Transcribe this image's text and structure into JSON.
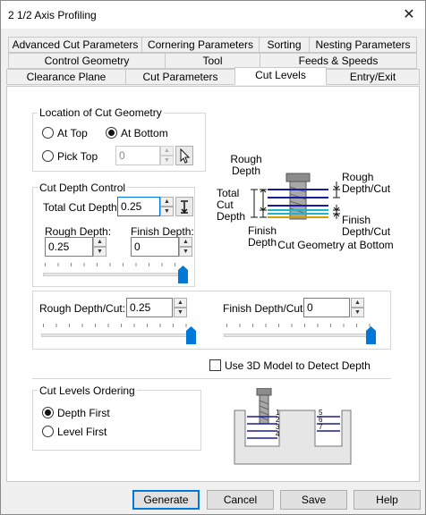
{
  "window": {
    "title": "2 1/2 Axis Profiling"
  },
  "tabs": {
    "row1": [
      "Advanced Cut Parameters",
      "Cornering Parameters",
      "Sorting",
      "Nesting Parameters"
    ],
    "row2": [
      "Control Geometry",
      "Tool",
      "Feeds & Speeds"
    ],
    "row3": [
      "Clearance Plane",
      "Cut Parameters",
      "Cut Levels",
      "Entry/Exit"
    ],
    "active": "Cut Levels"
  },
  "location": {
    "group_label": "Location of Cut Geometry",
    "at_top": "At Top",
    "at_bottom": "At Bottom",
    "pick_top": "Pick Top",
    "pick_top_value": "0",
    "selected": "At Bottom"
  },
  "depth_control": {
    "group_label": "Cut Depth Control",
    "total_label": "Total Cut Depth:",
    "total_value": "0.25",
    "rough_label": "Rough Depth:",
    "rough_value": "0.25",
    "finish_label": "Finish Depth:",
    "finish_value": "0",
    "slider_fraction": 1.0
  },
  "per_cut": {
    "rough_label": "Rough Depth/Cut:",
    "rough_value": "0.25",
    "finish_label": "Finish Depth/Cut:",
    "finish_value": "0",
    "rough_slider_fraction": 1.0,
    "finish_slider_fraction": 1.0
  },
  "use_3d_model": {
    "label": "Use 3D Model to Detect Depth",
    "checked": false
  },
  "diagram": {
    "rough_depth": [
      "Rough",
      "Depth"
    ],
    "total_cut_depth": [
      "Total",
      "Cut",
      "Depth"
    ],
    "finish_depth": [
      "Finish",
      "Depth"
    ],
    "rough_depth_cut": [
      "Rough",
      "Depth/Cut"
    ],
    "finish_depth_cut": [
      "Finish",
      "Depth/Cut"
    ],
    "caption": "Cut Geometry at Bottom"
  },
  "ordering": {
    "group_label": "Cut Levels Ordering",
    "depth_first": "Depth First",
    "level_first": "Level First",
    "selected": "Depth First",
    "left_levels": [
      "1",
      "2",
      "3",
      "4"
    ],
    "right_levels": [
      "5",
      "6",
      "7"
    ]
  },
  "buttons": {
    "generate": "Generate",
    "cancel": "Cancel",
    "save": "Save",
    "help": "Help"
  },
  "colors": {
    "accent": "#0078d7",
    "level_line": "#1a1aa0",
    "finish_line": "#1fb5c8",
    "geometry_line": "#d4a000"
  }
}
